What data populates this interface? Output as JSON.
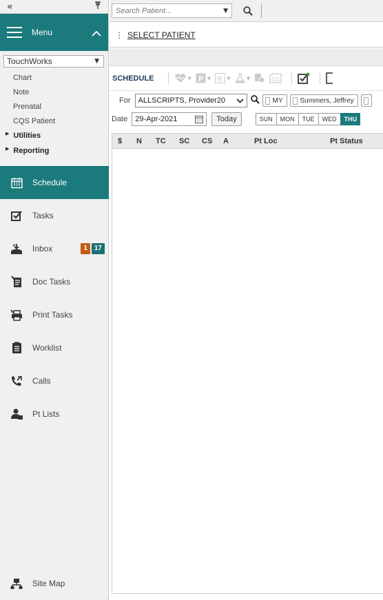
{
  "sidebar": {
    "collapse_glyph": "«",
    "pin_glyph": "⊤",
    "menu_label": "Menu",
    "menu_caret": "⌃",
    "context_select": "TouchWorks",
    "links": [
      {
        "label": "Chart"
      },
      {
        "label": "Note"
      },
      {
        "label": "Prenatal"
      },
      {
        "label": "CQS Patient"
      }
    ],
    "groups": [
      {
        "label": "Utilities"
      },
      {
        "label": "Reporting"
      }
    ],
    "items": [
      {
        "label": "Schedule",
        "icon": "calendar-icon",
        "active": true
      },
      {
        "label": "Tasks",
        "icon": "checkbox-icon"
      },
      {
        "label": "Inbox",
        "icon": "inbox-icon",
        "badges": [
          "1",
          "17"
        ]
      },
      {
        "label": "Doc Tasks",
        "icon": "doc-tasks-icon"
      },
      {
        "label": "Print Tasks",
        "icon": "printer-icon"
      },
      {
        "label": "Worklist",
        "icon": "worklist-icon"
      },
      {
        "label": "Calls",
        "icon": "phone-icon"
      },
      {
        "label": "Pt Lists",
        "icon": "patients-icon"
      }
    ],
    "site_map": {
      "label": "Site Map",
      "icon": "sitemap-icon"
    }
  },
  "topbar": {
    "search_placeholder": "Search Patient..."
  },
  "header": {
    "select_patient": "SELECT PATIENT"
  },
  "schedule": {
    "title": "SCHEDULE",
    "for_label": "For",
    "provider": "ALLSCRIPTS, Provider20",
    "my_label": "MY",
    "patient_pill": "Summers, Jeffrey",
    "date_label": "Date",
    "date_value": "29-Apr-2021",
    "today_label": "Today",
    "days": [
      "SUN",
      "MON",
      "TUE",
      "WED",
      "THU"
    ],
    "active_day": "THU",
    "columns": [
      "$",
      "N",
      "TC",
      "SC",
      "CS",
      "A",
      "Pt Loc",
      "Pt Status"
    ]
  },
  "colors": {
    "accent": "#1b7a7c",
    "badge_orange": "#c55a11"
  }
}
